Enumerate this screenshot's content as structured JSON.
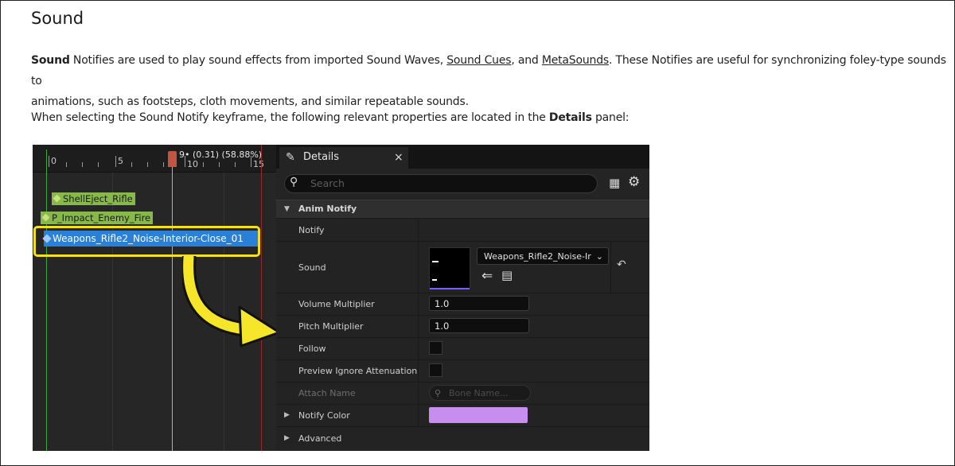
{
  "heading": "Sound",
  "para1": {
    "bold": "Sound",
    "t1": " Notifies are used to play sound effects from imported Sound Waves, ",
    "link1": "Sound Cues",
    "t2": ", and ",
    "link2": "MetaSounds",
    "t3": ". These Notifies are useful for synchronizing foley-type sounds to",
    "line2": "animations, such as footsteps, cloth movements, and similar repeatable sounds."
  },
  "para2": {
    "t1": "When selecting the Sound Notify keyframe, the following relevant properties are located in the ",
    "bold": "Details",
    "t2": " panel:"
  },
  "timeline": {
    "ticks": [
      "0",
      "5",
      "10",
      "15"
    ],
    "playhead_label": "9• (0.31) (58.88%)",
    "notifies": [
      "ShellEject_Rifle",
      "P_Impact_Enemy_Fire"
    ],
    "selected_notify": "Weapons_Rifle2_Noise-Interior-Close_01"
  },
  "details": {
    "tab_label": "Details",
    "close_glyph": "×",
    "search_placeholder": "Search",
    "category": "Anim Notify",
    "rows": {
      "notify": "Notify",
      "sound": "Sound",
      "volume": "Volume Multiplier",
      "pitch": "Pitch Multiplier",
      "follow": "Follow",
      "preview": "Preview Ignore Attenuation",
      "attach": "Attach Name",
      "color": "Notify Color",
      "advanced": "Advanced"
    },
    "sound_asset": "Weapons_Rifle2_Noise-Ir",
    "volume_value": "1.0",
    "pitch_value": "1.0",
    "bone_placeholder": "Bone Name...",
    "notify_color": "#c78ef0"
  },
  "colors": {
    "highlight": "#f2e024",
    "selection": "#2a7fd6",
    "notify_green": "#86b84a"
  },
  "icons": [
    "edit-icon",
    "close-icon",
    "search-icon",
    "table-icon",
    "gear-icon",
    "use-selected-icon",
    "browse-icon",
    "reset-icon",
    "chevron-down-icon",
    "arrow-icon"
  ]
}
